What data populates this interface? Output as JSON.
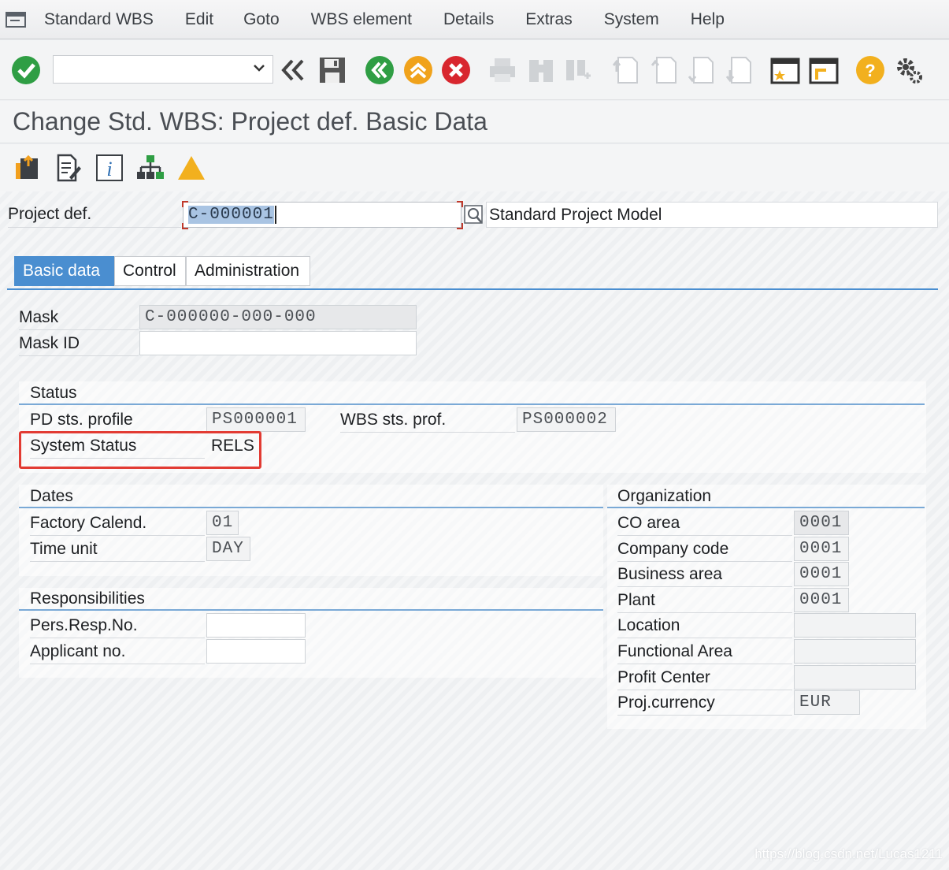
{
  "menu": {
    "items": [
      {
        "label": "Standard WBS"
      },
      {
        "label": "Edit"
      },
      {
        "label": "Goto"
      },
      {
        "label": "WBS element"
      },
      {
        "label": "Details"
      },
      {
        "label": "Extras"
      },
      {
        "label": "System"
      },
      {
        "label": "Help"
      }
    ]
  },
  "toolbar": {
    "command_field_value": "",
    "icons": [
      "check-icon",
      "back-double-icon",
      "save-icon",
      "back-icon",
      "exit-icon",
      "cancel-icon",
      "print-icon",
      "find-icon",
      "find-next-icon",
      "first-page-icon",
      "previous-page-icon",
      "next-page-icon",
      "last-page-icon",
      "new-session-icon",
      "shortcut-icon",
      "help-icon",
      "settings-icon"
    ]
  },
  "title": "Change Std. WBS: Project def. Basic Data",
  "app_toolbar": {
    "icons": [
      "open-project-icon",
      "edit-doc-icon",
      "info-icon",
      "hierarchy-icon",
      "warning-icon"
    ]
  },
  "header": {
    "project_def_label": "Project def.",
    "project_def_value": "C-000001",
    "project_def_description": "Standard Project Model"
  },
  "tabs": [
    {
      "label": "Basic data",
      "active": true
    },
    {
      "label": "Control",
      "active": false
    },
    {
      "label": "Administration",
      "active": false
    }
  ],
  "mask": {
    "mask_label": "Mask",
    "mask_value": "C-000000-000-000",
    "mask_id_label": "Mask ID",
    "mask_id_value": ""
  },
  "status": {
    "title": "Status",
    "pd_profile_label": "PD sts. profile",
    "pd_profile_value": "PS000001",
    "wbs_profile_label": "WBS sts. prof.",
    "wbs_profile_value": "PS000002",
    "system_status_label": "System Status",
    "system_status_value": "RELS"
  },
  "dates": {
    "title": "Dates",
    "factory_calendar_label": "Factory Calend.",
    "factory_calendar_value": "01",
    "time_unit_label": "Time unit",
    "time_unit_value": "DAY"
  },
  "responsibilities": {
    "title": "Responsibilities",
    "pers_resp_label": "Pers.Resp.No.",
    "pers_resp_value": "",
    "applicant_label": "Applicant no.",
    "applicant_value": ""
  },
  "organization": {
    "title": "Organization",
    "rows": [
      {
        "label": "CO area",
        "value": "0001"
      },
      {
        "label": "Company code",
        "value": "0001"
      },
      {
        "label": "Business area",
        "value": "0001"
      },
      {
        "label": "Plant",
        "value": "0001"
      },
      {
        "label": "Location",
        "value": ""
      },
      {
        "label": "Functional Area",
        "value": ""
      },
      {
        "label": "Profit Center",
        "value": ""
      },
      {
        "label": "Proj.currency",
        "value": "EUR"
      }
    ]
  },
  "watermark": "https://blog.csdn.net/Lucas1211",
  "colors": {
    "accent": "#4a8ed0",
    "highlight": "#e23b33"
  }
}
